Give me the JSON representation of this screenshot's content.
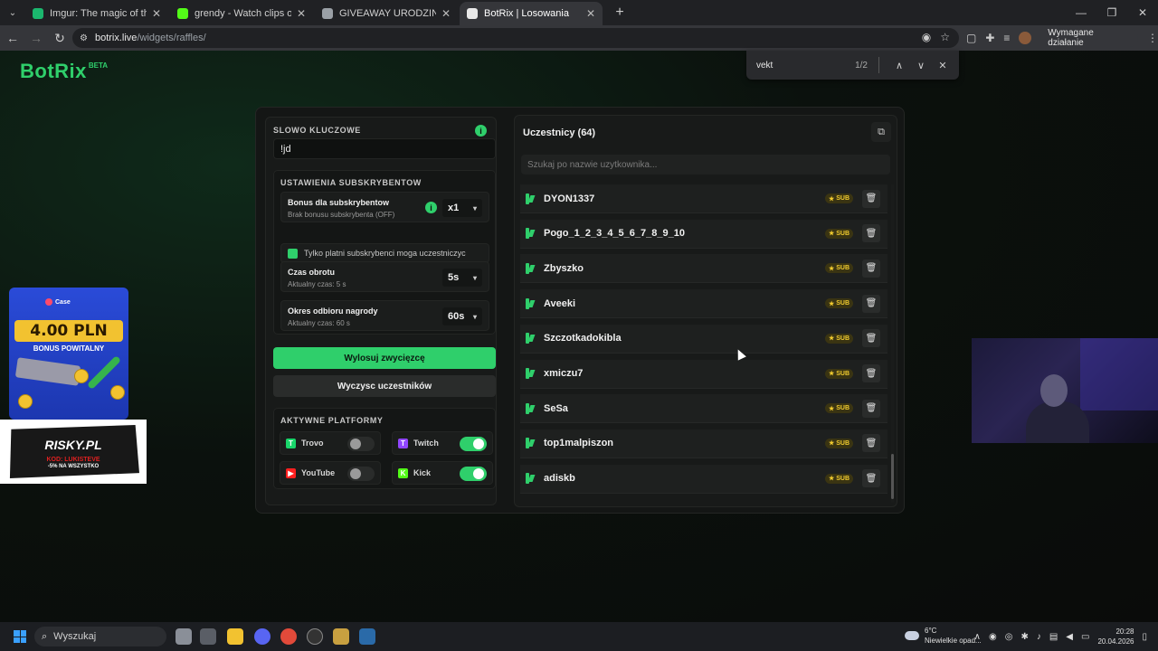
{
  "browser": {
    "tabs": [
      {
        "title": "Imgur: The magic of the Interne",
        "fav_color": "#1bb76e",
        "active": false
      },
      {
        "title": "grendy - Watch clips on Kick",
        "fav_color": "#53fc18",
        "active": false
      },
      {
        "title": "GIVEAWAY URODZINOWY",
        "fav_color": "#9aa0a6",
        "active": false
      },
      {
        "title": "BotRix | Losowania",
        "fav_color": "#e8e8e8",
        "active": true
      }
    ],
    "url_host": "botrix.live",
    "url_path": "/widgets/raffles/",
    "action_label": "Wymagane działanie",
    "find": {
      "query": "vekt",
      "count": "1/2"
    }
  },
  "brand": {
    "name": "BotRix",
    "badge": "BETA"
  },
  "keyword": {
    "label": "SLOWO KLUCZOWE",
    "value": "!jd"
  },
  "sub_settings": {
    "label": "USTAWIENIA SUBSKRYBENTOW",
    "bonus": {
      "title": "Bonus dla subskrybentow",
      "subtitle": "Brak bonusu subskrybenta (OFF)",
      "value": "x1"
    },
    "only_paid": "Tylko platni subskrybenci moga uczestniczyc",
    "spin": {
      "title": "Czas obrotu",
      "subtitle": "Aktualny czas: 5 s",
      "value": "5s"
    },
    "claim": {
      "title": "Okres odbioru nagrody",
      "subtitle": "Aktualny czas: 60 s",
      "value": "60s"
    }
  },
  "buttons": {
    "draw": "Wylosuj zwycięzcę",
    "clear": "Wyczysc uczestników"
  },
  "platforms": {
    "label": "AKTYWNE PLATFORMY",
    "items": [
      {
        "name": "Trovo",
        "enabled": false,
        "color": "#19d66b",
        "glyph": "T"
      },
      {
        "name": "Twitch",
        "enabled": true,
        "color": "#9146ff",
        "glyph": "T"
      },
      {
        "name": "YouTube",
        "enabled": false,
        "color": "#ff2020",
        "glyph": "▶"
      },
      {
        "name": "Kick",
        "enabled": true,
        "color": "#53fc18",
        "glyph": "K"
      }
    ]
  },
  "participants": {
    "title": "Uczestnicy (64)",
    "search_placeholder": "Szukaj po nazwie uzytkownika...",
    "sub_label": "SUB",
    "users": [
      "DYON1337",
      "Pogo_1_2_3_4_5_6_7_8_9_10",
      "Zbyszko",
      "Aveeki",
      "Szczotkadokibla",
      "xmiczu7",
      "SeSa",
      "top1malpiszon",
      "adiskb"
    ]
  },
  "ads": {
    "case_brand": "Case",
    "case_amount": "4.00 PLN",
    "case_bonus": "BONUS POWITALNY",
    "risky_title": "RISKY.PL",
    "risky_code": "KOD: LUKISTEVE",
    "risky_discount": "-5% NA WSZYSTKO"
  },
  "taskbar": {
    "search": "Wyszukaj",
    "temp": "6°C",
    "weather": "Niewielkie opad...",
    "time": "20:28",
    "date": "20.04.2026"
  },
  "colors": {
    "accent": "#2fcf6b",
    "sub_badge": "#f2cc2f"
  }
}
